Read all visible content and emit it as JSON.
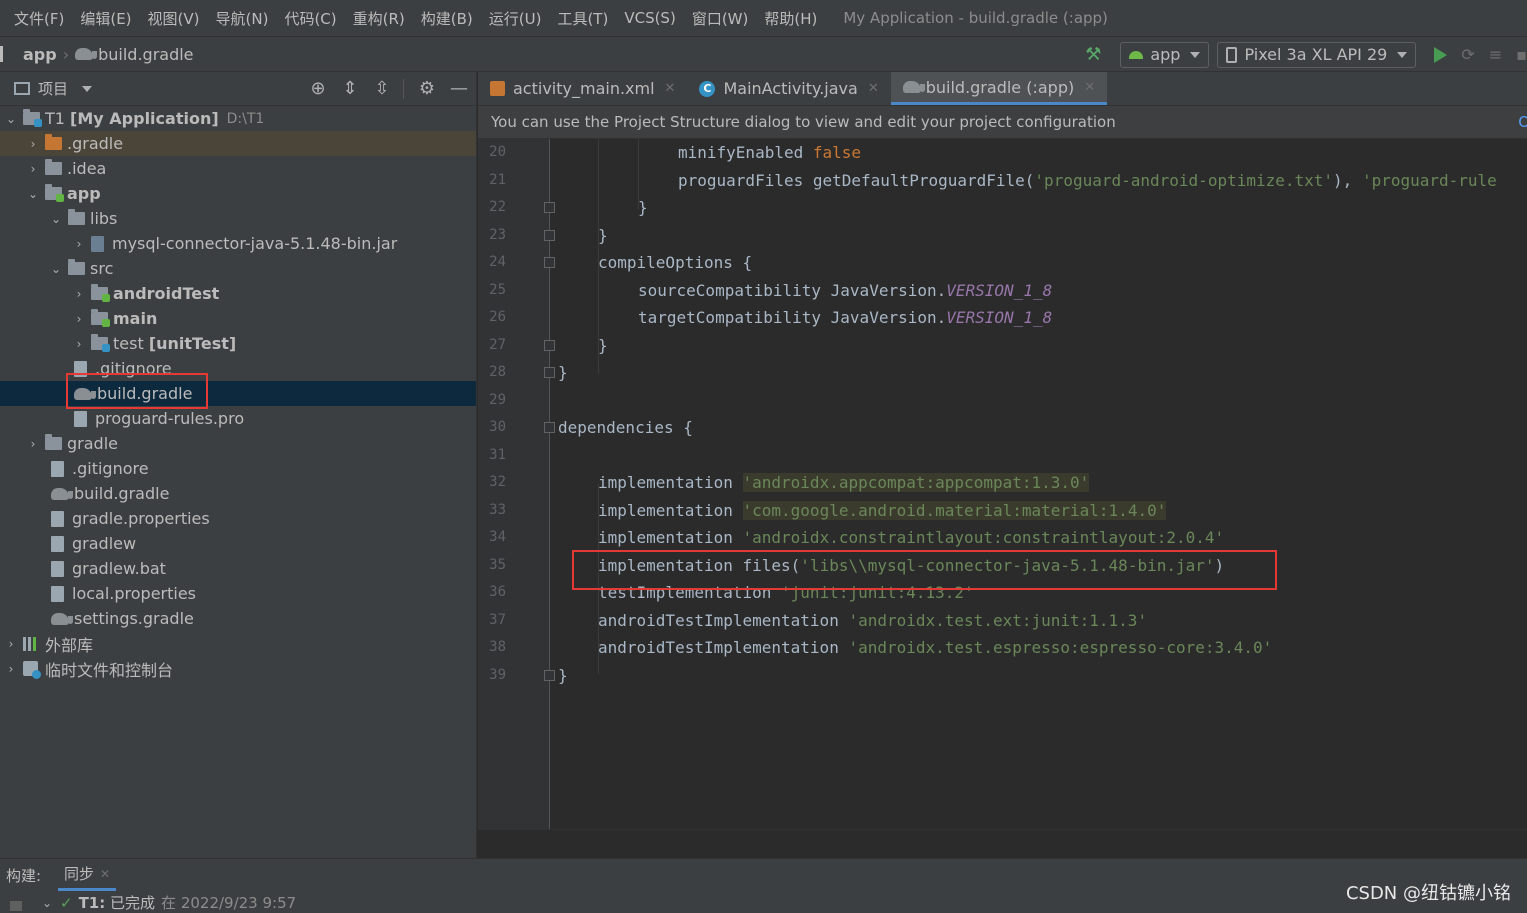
{
  "menu": {
    "items": [
      "文件(F)",
      "编辑(E)",
      "视图(V)",
      "导航(N)",
      "代码(C)",
      "重构(R)",
      "构建(B)",
      "运行(U)",
      "工具(T)",
      "VCS(S)",
      "窗口(W)",
      "帮助(H)"
    ],
    "window_title": "My Application - build.gradle (:app)"
  },
  "navbar": {
    "crumb_module": "app",
    "crumb_file": "build.gradle",
    "run_config": "app",
    "device": "Pixel 3a XL API 29"
  },
  "project": {
    "header_label": "项目",
    "tree": [
      {
        "label": "T1",
        "extra": "[My Application]",
        "path": "D:\\T1"
      },
      {
        "label": ".gradle"
      },
      {
        "label": ".idea"
      },
      {
        "label": "app"
      },
      {
        "label": "libs"
      },
      {
        "label": "mysql-connector-java-5.1.48-bin.jar"
      },
      {
        "label": "src"
      },
      {
        "label": "androidTest"
      },
      {
        "label": "main"
      },
      {
        "label": "test",
        "extra": "[unitTest]"
      },
      {
        "label": ".gitignore"
      },
      {
        "label": "build.gradle"
      },
      {
        "label": "proguard-rules.pro"
      },
      {
        "label": "gradle"
      },
      {
        "label": ".gitignore"
      },
      {
        "label": "build.gradle"
      },
      {
        "label": "gradle.properties"
      },
      {
        "label": "gradlew"
      },
      {
        "label": "gradlew.bat"
      },
      {
        "label": "local.properties"
      },
      {
        "label": "settings.gradle"
      },
      {
        "label": "外部库"
      },
      {
        "label": "临时文件和控制台"
      }
    ]
  },
  "editor": {
    "tabs": [
      {
        "label": "activity_main.xml"
      },
      {
        "label": "MainActivity.java"
      },
      {
        "label": "build.gradle (:app)"
      }
    ],
    "banner": "You can use the Project Structure dialog to view and edit your project configuration",
    "line_numbers": [
      "20",
      "21",
      "22",
      "23",
      "24",
      "25",
      "26",
      "27",
      "28",
      "29",
      "30",
      "31",
      "32",
      "33",
      "34",
      "35",
      "36",
      "37",
      "38",
      "39"
    ],
    "code": {
      "l20_a": "minifyEnabled ",
      "l20_b": "false",
      "l21_a": "proguardFiles getDefaultProguardFile(",
      "l21_b": "'proguard-android-optimize.txt'",
      "l21_c": "), ",
      "l21_d": "'proguard-rule",
      "l22": "}",
      "l23": "}",
      "l24": "compileOptions {",
      "l25_a": "sourceCompatibility JavaVersion.",
      "l25_b": "VERSION_1_8",
      "l26_a": "targetCompatibility JavaVersion.",
      "l26_b": "VERSION_1_8",
      "l27": "}",
      "l28": "}",
      "l30": "dependencies {",
      "l32_a": "implementation ",
      "l32_b": "'androidx.appcompat:appcompat:1.3.0'",
      "l33_a": "implementation ",
      "l33_b": "'com.google.android.material:material:1.4.0'",
      "l34_a": "implementation ",
      "l34_b": "'androidx.constraintlayout:constraintlayout:2.0.4'",
      "l35_a": "implementation files(",
      "l35_b": "'libs\\\\mysql-connector-java-5.1.48-bin.jar'",
      "l35_c": ")",
      "l36_a": "testImplementation ",
      "l36_b": "'junit:junit:4.13.2'",
      "l37_a": "androidTestImplementation ",
      "l37_b": "'androidx.test.ext:junit:1.1.3'",
      "l38_a": "androidTestImplementation ",
      "l38_b": "'androidx.test.espresso:espresso-core:3.4.0'",
      "l39": "}"
    }
  },
  "build": {
    "label": "构建:",
    "tab": "同步",
    "status_name": "T1:",
    "status_text": "已完成",
    "status_time": "在 2022/9/23 9:57"
  },
  "watermark": "CSDN @纽钴镳小铭",
  "colors": {
    "highlight_box": "#e53935",
    "keyword": "#cc7832",
    "string": "#6a8759",
    "constant": "#9876aa",
    "selection": "#0d293e"
  }
}
